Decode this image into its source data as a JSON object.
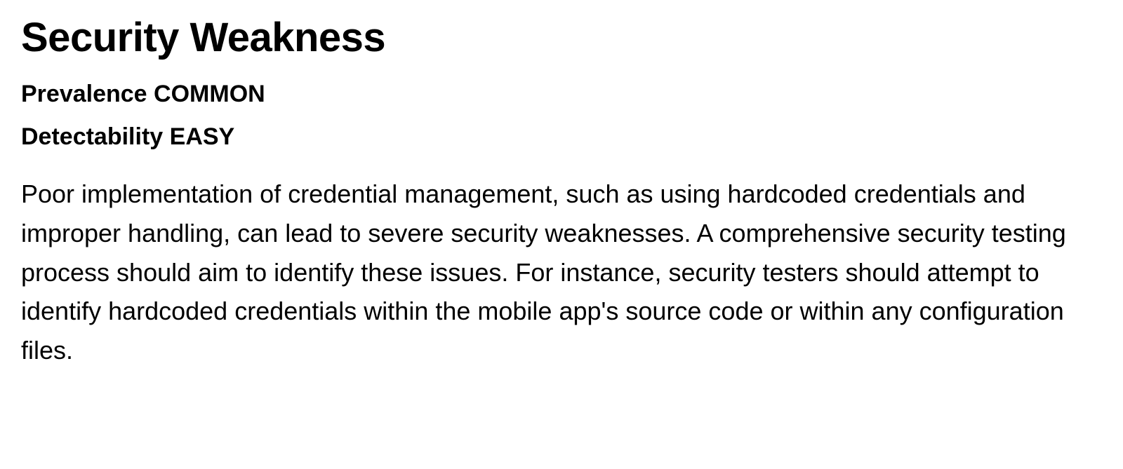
{
  "heading": "Security Weakness",
  "prevalence": {
    "label": "Prevalence",
    "value": "COMMON"
  },
  "detectability": {
    "label": "Detectability",
    "value": "EASY"
  },
  "body": "Poor implementation of credential management, such as using hardcoded credentials and improper handling, can lead to severe security weaknesses. A comprehensive security testing process should aim to identify these issues. For instance, security testers should attempt to identify hardcoded credentials within the mobile app's source code or within any configuration files."
}
